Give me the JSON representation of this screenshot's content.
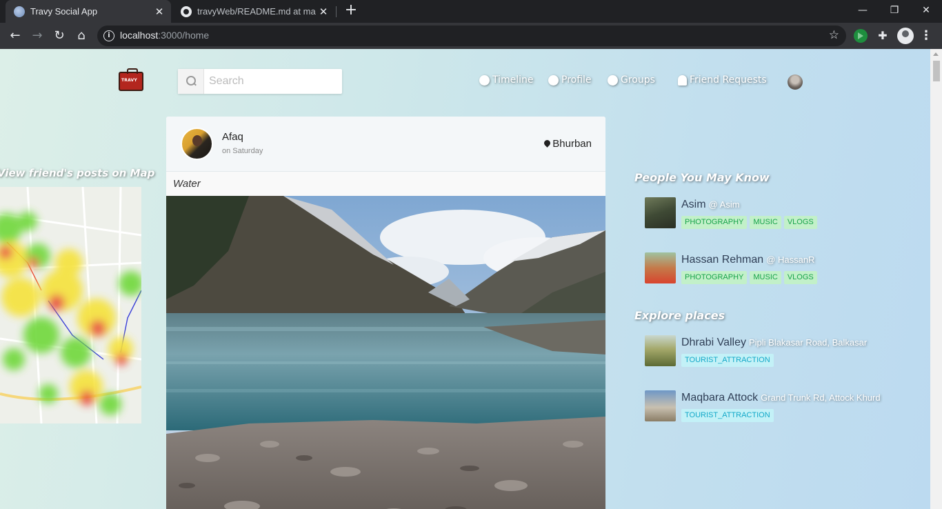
{
  "browser": {
    "tabs": [
      {
        "title": "Travy Social App",
        "active": true
      },
      {
        "title": "travyWeb/README.md at master",
        "active": false
      }
    ],
    "url_host": "localhost",
    "url_path": ":3000/home",
    "icons": {
      "back": "arrow-left-icon",
      "forward": "arrow-right-icon",
      "reload": "reload-icon",
      "home": "home-icon",
      "bookmark": "star-icon",
      "extensions": "puzzle-icon",
      "menu": "kebab-menu-icon"
    }
  },
  "header": {
    "logo_text": "TRAVY",
    "search_placeholder": "Search",
    "nav": [
      {
        "label": "Timeline",
        "icon": "globe-icon"
      },
      {
        "label": "Profile",
        "icon": "user-icon"
      },
      {
        "label": "Groups",
        "icon": "group-icon"
      },
      {
        "label": "Friend Requests",
        "icon": "bell-icon"
      }
    ]
  },
  "map": {
    "title": "View friend's posts on Map"
  },
  "post": {
    "author": "Afaq",
    "date": "on Saturday",
    "location": "Bhurban",
    "caption": "Water"
  },
  "people": {
    "title": "People You May Know",
    "items": [
      {
        "name": "Asim",
        "handle": "@ Asim",
        "tags": [
          "PHOTOGRAPHY",
          "MUSIC",
          "VLOGS"
        ]
      },
      {
        "name": "Hassan Rehman",
        "handle": "@ HassanR",
        "tags": [
          "PHOTOGRAPHY",
          "MUSIC",
          "VLOGS"
        ]
      }
    ]
  },
  "places": {
    "title": "Explore places",
    "items": [
      {
        "name": "Dhrabi Valley",
        "address": "Pipli Blakasar Road, Balkasar",
        "tags": [
          "TOURIST_ATTRACTION"
        ]
      },
      {
        "name": "Maqbara Attock",
        "address": "Grand Trunk Rd, Attock Khurd",
        "tags": [
          "TOURIST_ATTRACTION"
        ]
      }
    ]
  },
  "colors": {
    "tag_green_bg": "#c2f0c9",
    "tag_green_text": "#18a34a",
    "tag_cyan_bg": "#c3f1f7",
    "tag_cyan_text": "#13a8c8",
    "heat_red": "#e8443a",
    "heat_yellow": "#f5e23a",
    "heat_green": "#6fd83a"
  }
}
